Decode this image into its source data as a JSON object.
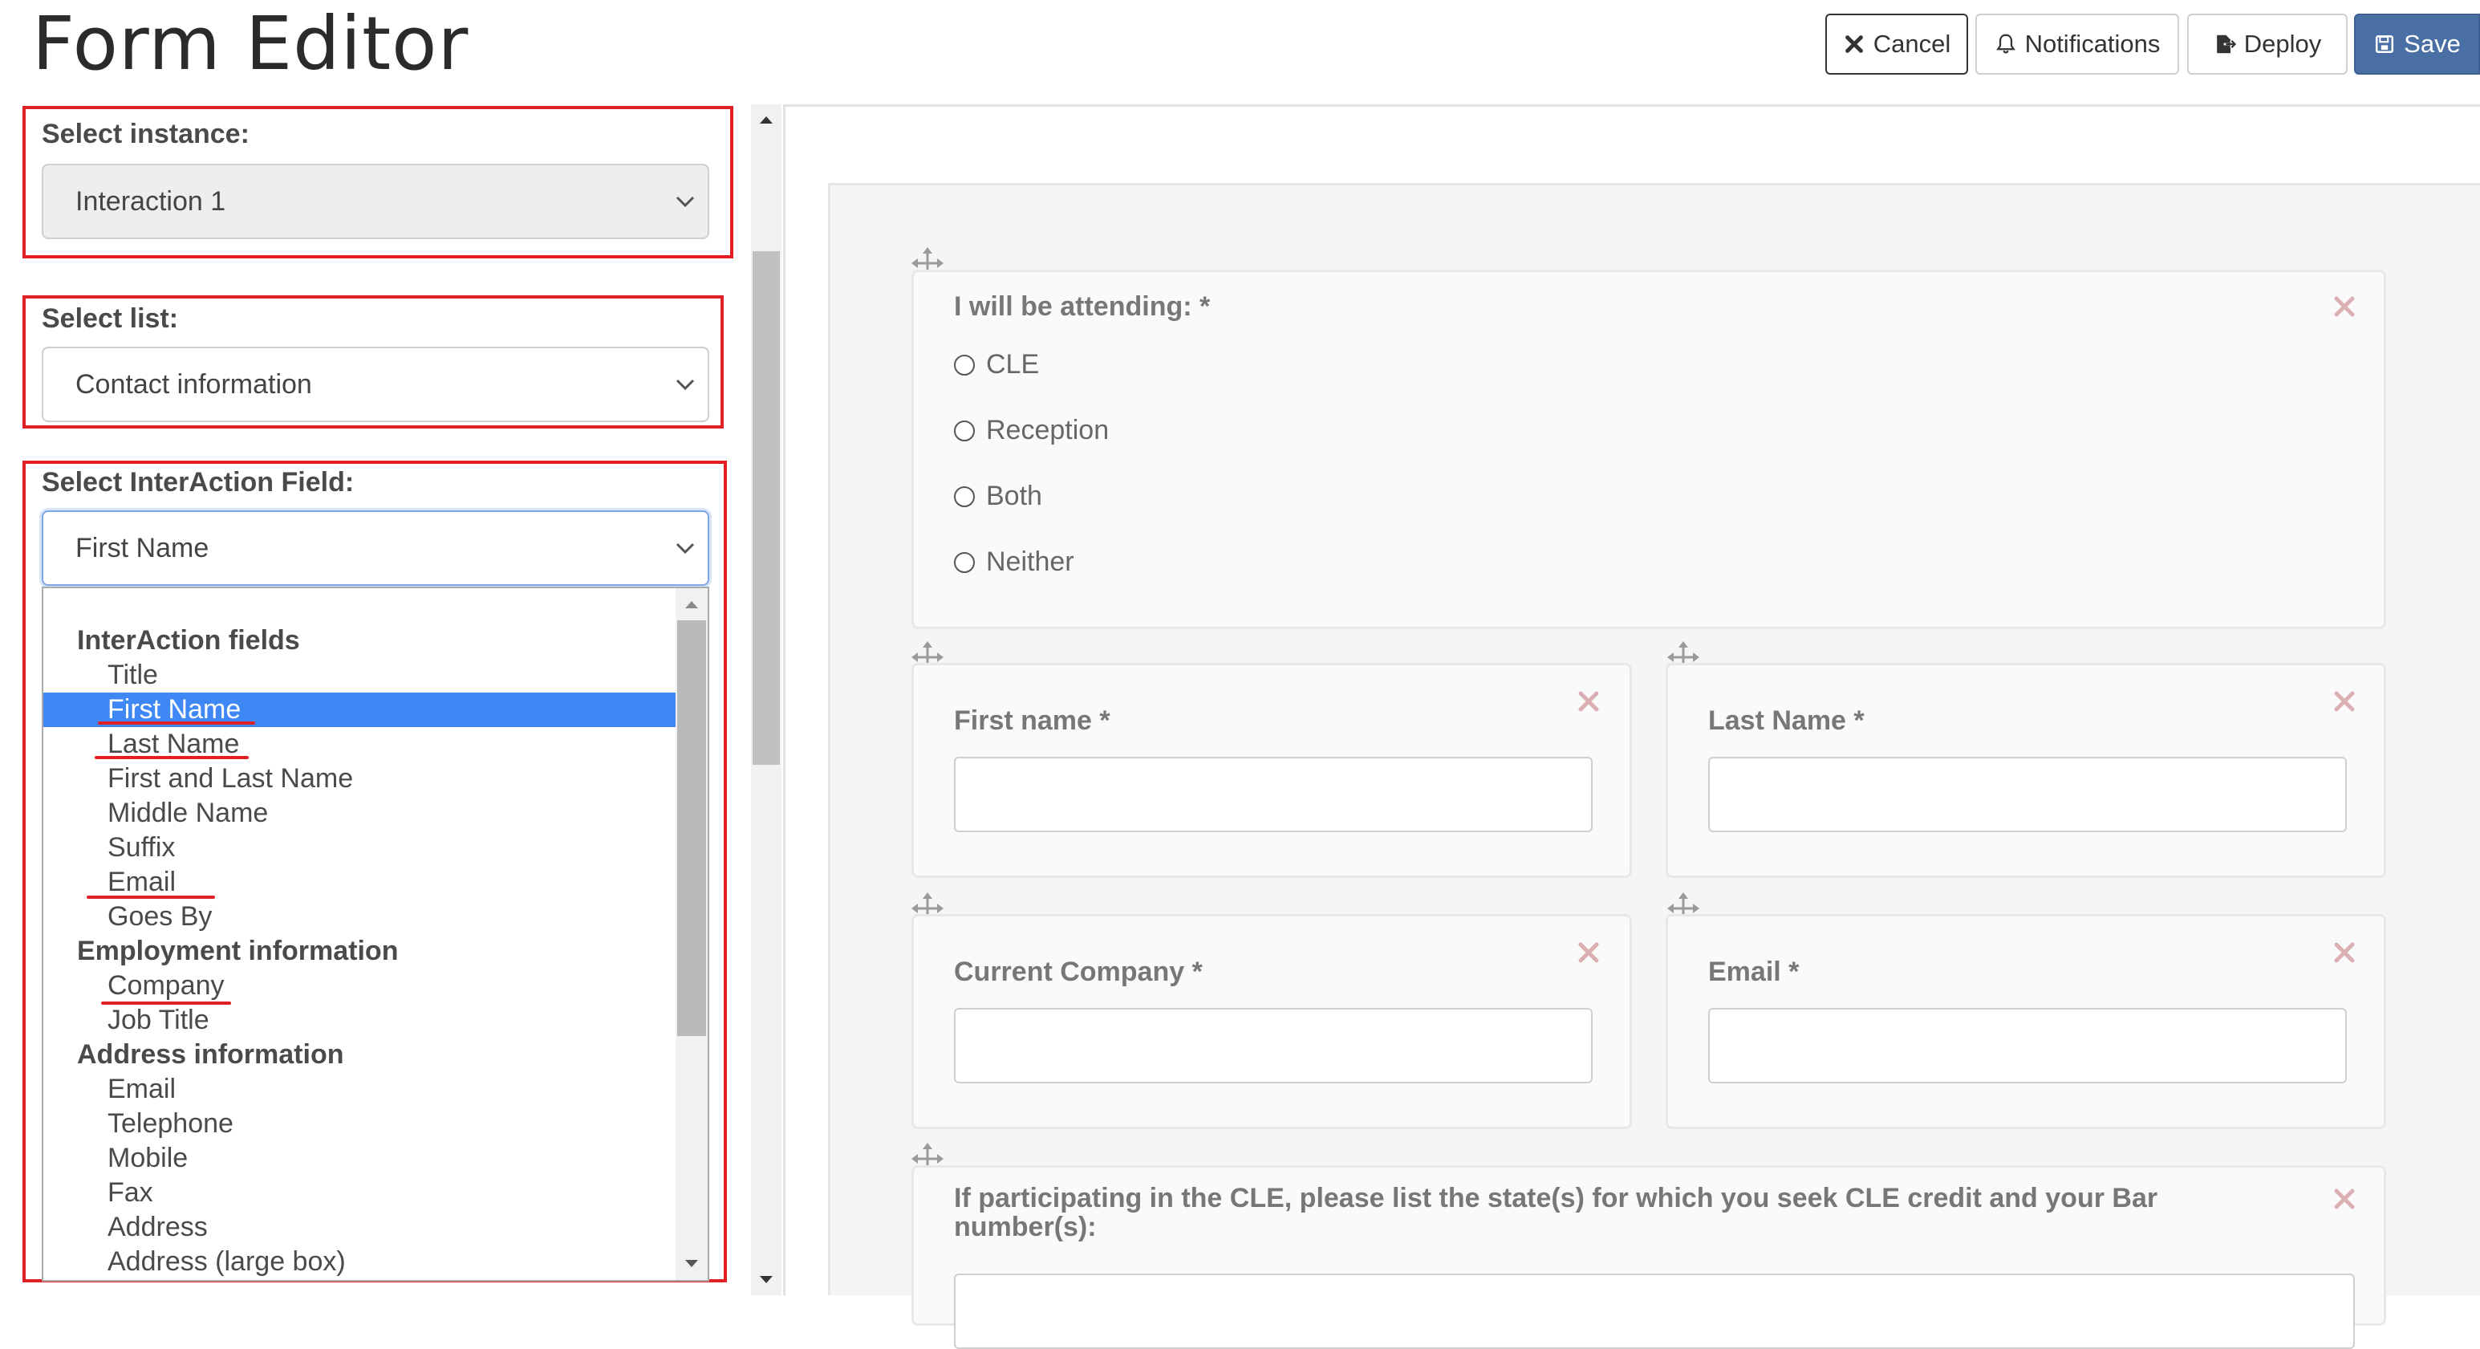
{
  "header": {
    "title": "Form Editor",
    "buttons": {
      "cancel": "Cancel",
      "notifications": "Notifications",
      "deploy": "Deploy",
      "save": "Save"
    }
  },
  "left_panel": {
    "instance": {
      "label": "Select instance:",
      "value": "Interaction 1"
    },
    "list": {
      "label": "Select list:",
      "value": "Contact information"
    },
    "field": {
      "label": "Select InterAction Field:",
      "value": "First Name"
    },
    "options": [
      {
        "text": "InterAction fields",
        "type": "group"
      },
      {
        "text": "Title",
        "type": "item"
      },
      {
        "text": "First Name",
        "type": "item",
        "selected": true
      },
      {
        "text": "Last Name",
        "type": "item"
      },
      {
        "text": "First and Last Name",
        "type": "item"
      },
      {
        "text": "Middle Name",
        "type": "item"
      },
      {
        "text": "Suffix",
        "type": "item"
      },
      {
        "text": "Email",
        "type": "item"
      },
      {
        "text": "Goes By",
        "type": "item"
      },
      {
        "text": "Employment information",
        "type": "group"
      },
      {
        "text": "Company",
        "type": "item"
      },
      {
        "text": "Job Title",
        "type": "item"
      },
      {
        "text": "Address information",
        "type": "group"
      },
      {
        "text": "Email",
        "type": "item"
      },
      {
        "text": "Telephone",
        "type": "item"
      },
      {
        "text": "Mobile",
        "type": "item"
      },
      {
        "text": "Fax",
        "type": "item"
      },
      {
        "text": "Address",
        "type": "item"
      },
      {
        "text": "Address (large box)",
        "type": "item"
      }
    ]
  },
  "form": {
    "attending": {
      "label": "I will be attending: *",
      "options": [
        "CLE",
        "Reception",
        "Both",
        "Neither"
      ]
    },
    "first_name": {
      "label": "First name *"
    },
    "last_name": {
      "label": "Last Name *"
    },
    "current_company": {
      "label": "Current Company *"
    },
    "email": {
      "label": "Email *"
    },
    "cle_states": {
      "label": "If participating in the CLE, please list the state(s) for which you seek CLE credit and your Bar number(s):"
    }
  },
  "colors": {
    "highlight_red": "#e02027",
    "save_button": "#4a6fa5",
    "selected_option": "#3f87f5"
  }
}
